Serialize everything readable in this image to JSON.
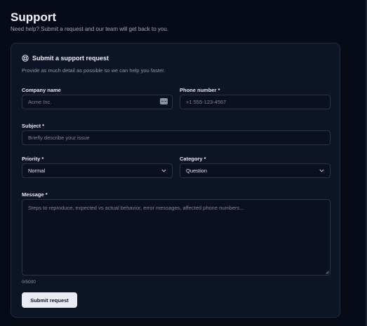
{
  "header": {
    "title": "Support",
    "subtitle": "Need help? Submit a request and our team will get back to you."
  },
  "card": {
    "icon": "lifebuoy-icon",
    "title": "Submit a support request",
    "description": "Provide as much detail as possible so we can help you faster."
  },
  "form": {
    "company": {
      "label": "Company name",
      "value": "",
      "placeholder": "Acme Inc."
    },
    "phone": {
      "label": "Phone number *",
      "value": "",
      "placeholder": "+1 555-123-4567"
    },
    "subject": {
      "label": "Subject *",
      "value": "",
      "placeholder": "Briefly describe your issue"
    },
    "priority": {
      "label": "Priority *",
      "selected": "Normal"
    },
    "category": {
      "label": "Category *",
      "selected": "Question"
    },
    "message": {
      "label": "Message *",
      "value": "",
      "placeholder": "Steps to reproduce, expected vs actual behavior, error messages, affected phone numbers..."
    },
    "counter": "0/5000",
    "submit_label": "Submit request"
  },
  "colors": {
    "background": "#070b18",
    "card": "#0d1425",
    "border": "#2a3347",
    "button": "#e9ecf2"
  }
}
